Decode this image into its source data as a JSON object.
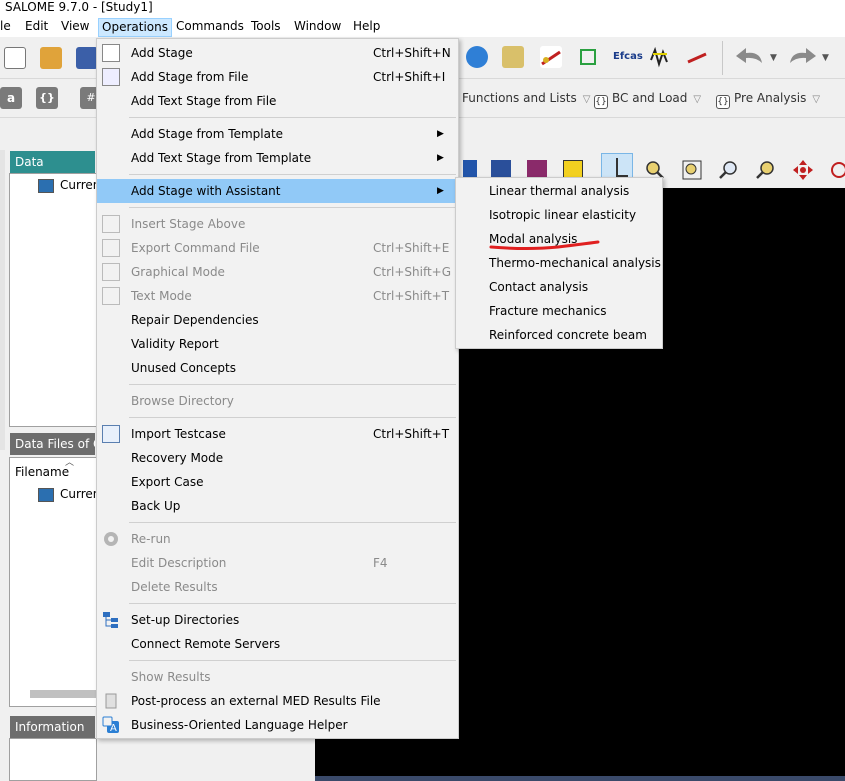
{
  "window": {
    "title": "SALOME 9.7.0 - [Study1]"
  },
  "menubar": {
    "items": [
      "le",
      "Edit",
      "View",
      "Operations",
      "Commands",
      "Tools",
      "Window",
      "Help"
    ]
  },
  "toolbar2": {
    "dropdowns": [
      {
        "label": "Functions and Lists"
      },
      {
        "label": "BC and Load",
        "icon_text": "{}"
      },
      {
        "label": "Pre Analysis",
        "icon_text": "{}"
      }
    ],
    "small_text": "a"
  },
  "left": {
    "data_settings_title": "Data Settings",
    "data_settings_item": "Curren",
    "data_files_title": "Data Files of C",
    "filename_header": "Filename",
    "data_files_item": "Curren",
    "information_title": "Information"
  },
  "ops_menu": {
    "items": [
      {
        "label": "Add Stage",
        "shortcut": "Ctrl+Shift+N",
        "disabled": false
      },
      {
        "label": "Add Stage from File",
        "shortcut": "Ctrl+Shift+I",
        "disabled": false
      },
      {
        "label": "Add Text Stage from File",
        "shortcut": "",
        "disabled": false
      },
      {
        "label": "Add Stage from Template",
        "shortcut": "",
        "disabled": false
      },
      {
        "label": "Add Text Stage from Template",
        "shortcut": "",
        "disabled": false
      },
      {
        "label": "Add Stage with Assistant",
        "shortcut": "",
        "disabled": false
      },
      {
        "label": "Insert Stage Above",
        "shortcut": "",
        "disabled": true
      },
      {
        "label": "Export Command File",
        "shortcut": "Ctrl+Shift+E",
        "disabled": true
      },
      {
        "label": "Graphical Mode",
        "shortcut": "Ctrl+Shift+G",
        "disabled": true
      },
      {
        "label": "Text Mode",
        "shortcut": "Ctrl+Shift+T",
        "disabled": true
      },
      {
        "label": "Repair Dependencies",
        "shortcut": "",
        "disabled": false
      },
      {
        "label": "Validity Report",
        "shortcut": "",
        "disabled": false
      },
      {
        "label": "Unused Concepts",
        "shortcut": "",
        "disabled": false
      },
      {
        "label": "Browse Directory",
        "shortcut": "",
        "disabled": true
      },
      {
        "label": "Import Testcase",
        "shortcut": "Ctrl+Shift+T",
        "disabled": false
      },
      {
        "label": "Recovery Mode",
        "shortcut": "",
        "disabled": false
      },
      {
        "label": "Export Case",
        "shortcut": "",
        "disabled": false
      },
      {
        "label": "Back Up",
        "shortcut": "",
        "disabled": false
      },
      {
        "label": "Re-run",
        "shortcut": "",
        "disabled": true
      },
      {
        "label": "Edit Description",
        "shortcut": "F4",
        "disabled": true
      },
      {
        "label": "Delete Results",
        "shortcut": "",
        "disabled": true
      },
      {
        "label": "Set-up Directories",
        "shortcut": "",
        "disabled": false
      },
      {
        "label": "Connect Remote Servers",
        "shortcut": "",
        "disabled": false
      },
      {
        "label": "Show Results",
        "shortcut": "",
        "disabled": true
      },
      {
        "label": "Post-process an external MED Results File",
        "shortcut": "",
        "disabled": false
      },
      {
        "label": "Business-Oriented Language Helper",
        "shortcut": "",
        "disabled": false
      }
    ]
  },
  "assistant_submenu": {
    "items": [
      "Linear thermal analysis",
      "Isotropic linear elasticity",
      "Modal analysis",
      "Thermo-mechanical analysis",
      "Contact analysis",
      "Fracture mechanics",
      "Reinforced concrete beam"
    ],
    "annotated_item": "Modal analysis",
    "annotation_color": "#e02020"
  },
  "colors": {
    "menu_highlight": "#91c9f7",
    "dock_title_teal": "#2d8f8f",
    "dock_title_gray": "#6d6d6d",
    "viewer_bg": "#000000"
  }
}
